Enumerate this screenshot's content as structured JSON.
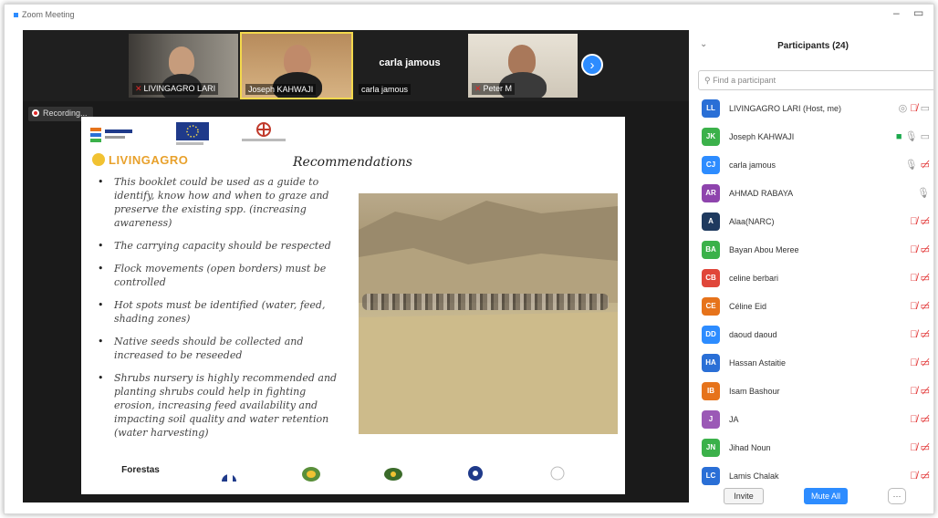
{
  "window": {
    "title": "Zoom Meeting"
  },
  "video_strip": {
    "tiles": [
      {
        "name": "LIVINGAGRO LARI",
        "muted": true
      },
      {
        "name": "Joseph KAHWAJI",
        "active": true
      },
      {
        "name": "carla jamous",
        "display_name": "carla jamous"
      },
      {
        "name": "Peter M",
        "muted": true
      }
    ]
  },
  "recording": {
    "label": "Recording..."
  },
  "slide": {
    "brand": "LIVINGAGRO",
    "title": "Recommendations",
    "bullets": [
      "This booklet could be used as a guide to identify, know how and when to graze and preserve the existing spp. (increasing awareness)",
      "The carrying capacity should be respected",
      "Flock movements (open borders) must be controlled",
      "Hot spots must be identified (water, feed, shading zones)",
      "Native seeds should be collected and increased to be reseeded",
      "Shrubs nursery is highly recommended and planting shrubs could help in fighting erosion, increasing feed availability and impacting soil quality and water retention (water harvesting)"
    ],
    "bottom_logo_text": "Forestas"
  },
  "participants_panel": {
    "title": "Participants (24)",
    "search_placeholder": "Find a participant",
    "participants": [
      {
        "initials": "LL",
        "name": "LIVINGAGRO LARI (Host, me)",
        "color": "#2a6fd6"
      },
      {
        "initials": "JK",
        "name": "Joseph KAHWAJI",
        "color": "#3bb14a"
      },
      {
        "initials": "CJ",
        "name": "carla jamous",
        "color": "#2d8cff"
      },
      {
        "initials": "AR",
        "name": "AHMAD RABAYA",
        "color": "#8e44ad"
      },
      {
        "initials": "A",
        "name": "Alaa(NARC)",
        "color": "#1f3a5f"
      },
      {
        "initials": "BA",
        "name": "Bayan Abou Meree",
        "color": "#3bb14a"
      },
      {
        "initials": "CB",
        "name": "celine berbari",
        "color": "#e0463a"
      },
      {
        "initials": "CE",
        "name": "Céline Eid",
        "color": "#e6731b"
      },
      {
        "initials": "DD",
        "name": "daoud daoud",
        "color": "#2d8cff"
      },
      {
        "initials": "HA",
        "name": "Hassan Astaitie",
        "color": "#2a6fd6"
      },
      {
        "initials": "IB",
        "name": "Isam Bashour",
        "color": "#e6731b"
      },
      {
        "initials": "J",
        "name": "JA",
        "color": "#9b59b6"
      },
      {
        "initials": "JN",
        "name": "Jihad Noun",
        "color": "#3bb14a"
      },
      {
        "initials": "LC",
        "name": "Lamis Chalak",
        "color": "#2a6fd6"
      }
    ],
    "invite_label": "Invite",
    "mute_all_label": "Mute All",
    "more_label": "···"
  }
}
